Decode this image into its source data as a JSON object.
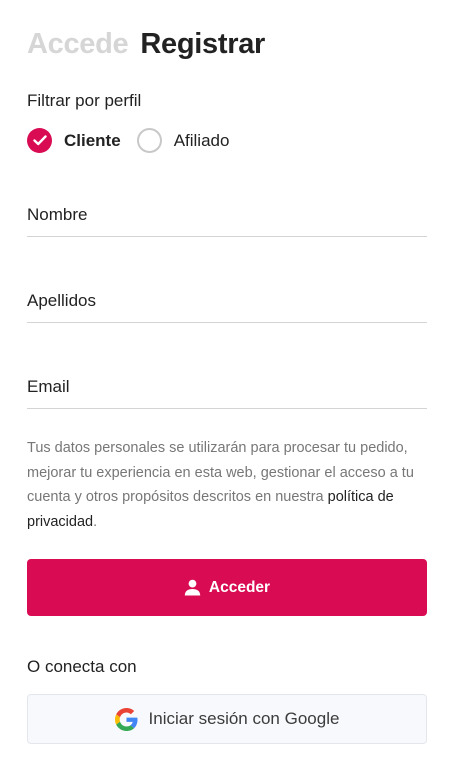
{
  "tabs": {
    "login_label": "Accede",
    "register_label": "Registrar"
  },
  "filter": {
    "label": "Filtrar por perfil",
    "options": [
      {
        "label": "Cliente",
        "selected": true
      },
      {
        "label": "Afiliado",
        "selected": false
      }
    ]
  },
  "form": {
    "name_placeholder": "Nombre",
    "lastname_placeholder": "Apellidos",
    "email_placeholder": "Email"
  },
  "privacy": {
    "text": "Tus datos personales se utilizarán para procesar tu pedido, mejorar tu experiencia en esta web, gestionar el acceso a tu cuenta y otros propósitos descritos en nuestra ",
    "link_text": "política de privacidad",
    "suffix": "."
  },
  "submit": {
    "label": "Acceder",
    "icon": "user-icon"
  },
  "social": {
    "label": "O conecta con",
    "google_label": "Iniciar sesión con Google",
    "google_icon": "google-icon"
  },
  "colors": {
    "accent": "#d90b52",
    "inactive_tab": "#d6d6d6",
    "muted_text": "#777777"
  }
}
